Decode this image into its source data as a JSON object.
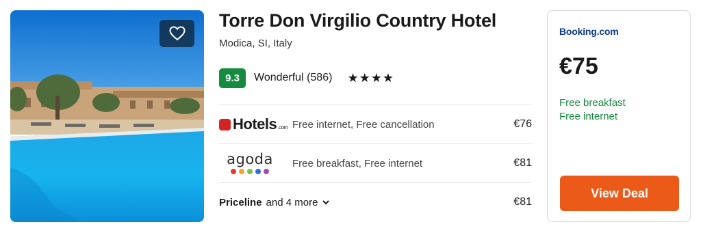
{
  "hotel": {
    "name": "Torre Don Virgilio Country Hotel",
    "location": "Modica, SI, Italy",
    "score": "9.3",
    "rating_text": "Wonderful (586)",
    "stars": "★★★★",
    "favorite_icon": "heart-outline-icon"
  },
  "offers": [
    {
      "provider": "Hotels.com",
      "logo_text": "Hotels",
      "logo_suffix": ".com",
      "description": "Free internet, Free cancellation",
      "price": "€76"
    },
    {
      "provider": "agoda",
      "logo_text": "agoda",
      "description": "Free breakfast, Free internet",
      "price": "€81"
    }
  ],
  "more": {
    "provider": "Priceline",
    "text": "and 4 more",
    "price": "€81"
  },
  "deal": {
    "provider": "Booking.com",
    "price": "€75",
    "perks": [
      "Free breakfast",
      "Free internet"
    ],
    "button_label": "View Deal"
  },
  "colors": {
    "score_bg": "#168b3f",
    "perk_text": "#168b3f",
    "button_bg": "#ec5a1a",
    "booking_blue": "#0b3b8a",
    "hotels_red": "#d32323",
    "agoda_dots": [
      "#e8382f",
      "#f6a623",
      "#7ac143",
      "#2a6ed8",
      "#a24ab4"
    ]
  }
}
